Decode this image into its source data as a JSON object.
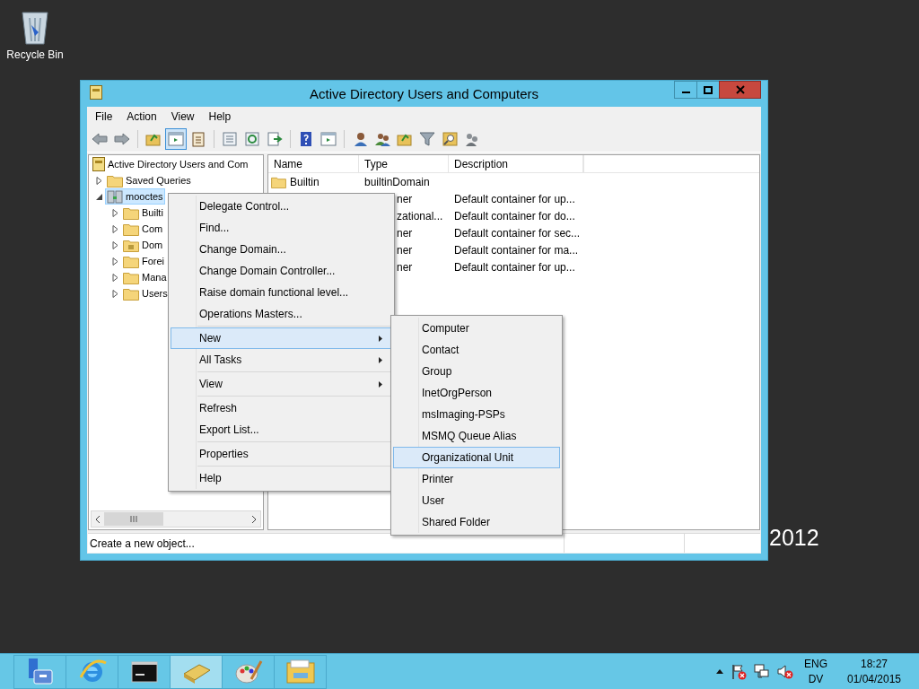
{
  "desktop": {
    "icons": [
      {
        "label": "Recycle Bin"
      }
    ],
    "wallpaper_text": "2012"
  },
  "window": {
    "title": "Active Directory Users and Computers",
    "menu_bar": [
      "File",
      "Action",
      "View",
      "Help"
    ],
    "toolbar_buttons": [
      {
        "selected": false
      },
      {
        "selected": false
      },
      {
        "selected": false
      },
      {
        "selected": true
      },
      {
        "selected": false
      },
      {
        "selected": false
      },
      {
        "selected": false
      },
      {
        "selected": false
      },
      {
        "selected": false
      },
      {
        "selected": false
      },
      {
        "selected": false
      },
      {
        "selected": false
      },
      {
        "selected": false
      },
      {
        "selected": false
      },
      {
        "selected": false
      },
      {
        "selected": false
      }
    ],
    "tree": [
      {
        "label": "Active Directory Users and Com",
        "kind": "root",
        "selected": false,
        "children": [
          {
            "label": "Saved Queries",
            "kind": "folder",
            "expanded": false,
            "selected": false
          },
          {
            "label": "mooctes",
            "kind": "domain",
            "expanded": true,
            "selected": true,
            "children": [
              {
                "label": "Builti",
                "kind": "folder",
                "expanded": false,
                "selected": false
              },
              {
                "label": "Com",
                "kind": "folder",
                "expanded": false,
                "selected": false
              },
              {
                "label": "Dom",
                "kind": "ou",
                "expanded": false,
                "selected": false
              },
              {
                "label": "Forei",
                "kind": "folder",
                "expanded": false,
                "selected": false
              },
              {
                "label": "Mana",
                "kind": "folder",
                "expanded": false,
                "selected": false
              },
              {
                "label": "Users",
                "kind": "folder",
                "expanded": false,
                "selected": false
              }
            ]
          }
        ]
      }
    ],
    "table": {
      "columns": [
        "Name",
        "Type",
        "Description"
      ],
      "rows": [
        {
          "name": "Builtin",
          "type": "builtinDomain"
        },
        {
          "type": "ner",
          "description": "Default container for up..."
        },
        {
          "type": "zational...",
          "description": "Default container for do..."
        },
        {
          "type": "ner",
          "description": "Default container for sec..."
        },
        {
          "type": "ner",
          "description": "Default container for ma..."
        },
        {
          "type": "ner",
          "description": "Default container for up..."
        }
      ]
    },
    "status_bar": "Create a new object..."
  },
  "context_menu": {
    "items": [
      {
        "kind": "item",
        "label": "Delegate Control...",
        "selected": false,
        "submenu": false
      },
      {
        "kind": "item",
        "label": "Find...",
        "selected": false,
        "submenu": false
      },
      {
        "kind": "item",
        "label": "Change Domain...",
        "selected": false,
        "submenu": false
      },
      {
        "kind": "item",
        "label": "Change Domain Controller...",
        "selected": false,
        "submenu": false
      },
      {
        "kind": "item",
        "label": "Raise domain functional level...",
        "selected": false,
        "submenu": false
      },
      {
        "kind": "item",
        "label": "Operations Masters...",
        "selected": false,
        "submenu": false
      },
      {
        "kind": "separator"
      },
      {
        "kind": "item",
        "label": "New",
        "selected": true,
        "submenu": true
      },
      {
        "kind": "item",
        "label": "All Tasks",
        "selected": false,
        "submenu": true
      },
      {
        "kind": "separator"
      },
      {
        "kind": "item",
        "label": "View",
        "selected": false,
        "submenu": true
      },
      {
        "kind": "separator"
      },
      {
        "kind": "item",
        "label": "Refresh",
        "selected": false,
        "submenu": false
      },
      {
        "kind": "item",
        "label": "Export List...",
        "selected": false,
        "submenu": false
      },
      {
        "kind": "separator"
      },
      {
        "kind": "item",
        "label": "Properties",
        "selected": false,
        "submenu": false
      },
      {
        "kind": "separator"
      },
      {
        "kind": "item",
        "label": "Help",
        "selected": false,
        "submenu": false
      }
    ]
  },
  "submenu": {
    "items": [
      {
        "label": "Computer",
        "selected": false
      },
      {
        "label": "Contact",
        "selected": false
      },
      {
        "label": "Group",
        "selected": false
      },
      {
        "label": "InetOrgPerson",
        "selected": false
      },
      {
        "label": "msImaging-PSPs",
        "selected": false
      },
      {
        "label": "MSMQ Queue Alias",
        "selected": false
      },
      {
        "label": "Organizational Unit",
        "selected": true
      },
      {
        "label": "Printer",
        "selected": false
      },
      {
        "label": "User",
        "selected": false
      },
      {
        "label": "Shared Folder",
        "selected": false
      }
    ]
  },
  "taskbar": {
    "apps": [
      {
        "selected": false
      },
      {
        "selected": false
      },
      {
        "selected": false
      },
      {
        "selected": true
      },
      {
        "selected": false
      },
      {
        "selected": false
      }
    ],
    "language": "ENG",
    "layout": "DV",
    "time": "18:27",
    "date": "01/04/2015"
  }
}
